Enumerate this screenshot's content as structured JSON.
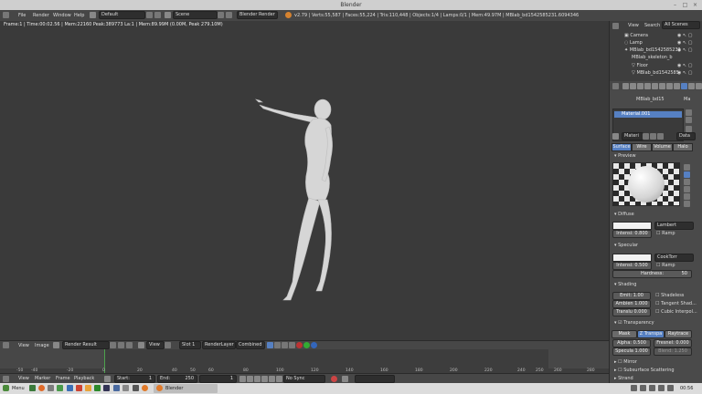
{
  "window": {
    "title": "Blender"
  },
  "topbar": {
    "menus": [
      "File",
      "Render",
      "Window",
      "Help"
    ],
    "layout": "Default",
    "scene": "Scene",
    "engine": "Blender Render",
    "stats": "v2.79 | Verts:55,587 | Faces:55,224 | Tris:110,448 | Objects:1/4 | Lamps:0/1 | Mem:49.97M | MBlab_bd1542585231.6094346"
  },
  "viewport": {
    "info": "Frame:1 | Time:00:02.56 | Mem:22160 Peak:389773 La:1 | Mem:89.99M (0.00M, Peak 279.10M)"
  },
  "image_editor_header": {
    "menus": [
      "View",
      "Image"
    ],
    "image_name": "Render Result",
    "view_label": "View",
    "slot": "Slot 1",
    "layer": "RenderLayer",
    "pass": "Combined"
  },
  "timeline": {
    "ticks": [
      "-50",
      "-40",
      "-20",
      "0",
      "20",
      "40",
      "50",
      "60",
      "80",
      "100",
      "120",
      "140",
      "160",
      "180",
      "200",
      "220",
      "240",
      "250",
      "260",
      "280"
    ],
    "menus": [
      "View",
      "Marker",
      "Frame",
      "Playback"
    ],
    "start_label": "Start:",
    "start_value": "1",
    "end_label": "End:",
    "end_value": "250",
    "current": "1",
    "sync": "No Sync"
  },
  "outliner": {
    "tabs": [
      "View",
      "Search",
      "All Scenes"
    ],
    "items": [
      "Camera",
      "Lamp",
      "MBlab_bd1542585231",
      "MBlab_skeleton_b",
      "Floor",
      "MBlab_bd1542585"
    ]
  },
  "properties": {
    "breadcrumb": [
      "MBlab_bd15",
      "Ma"
    ],
    "material_slot": "Material.001",
    "material_name": "Materi",
    "data_label": "Data",
    "tabs": [
      "Surface",
      "Wire",
      "Volume",
      "Halo"
    ],
    "sections": {
      "preview": "Preview",
      "diffuse": "Diffuse",
      "specular": "Specular",
      "shading": "Shading",
      "transparency": "Transparency",
      "mirror": "Mirror",
      "sss": "Subsurface Scattering",
      "strand": "Strand"
    },
    "diffuse": {
      "shader": "Lambert",
      "intensity_label": "Intensi",
      "intensity": "0.800",
      "ramp": "Ramp"
    },
    "specular": {
      "shader": "CookTorr",
      "intensity_label": "Intensi",
      "intensity": "0.500",
      "ramp": "Ramp",
      "hardness_label": "Hardness:",
      "hardness": "50"
    },
    "shading": {
      "emit_label": "Emit:",
      "emit": "1.00",
      "ambient_label": "Ambien",
      "ambient": "1.000",
      "translu_label": "Translu",
      "translu": "0.000",
      "shadeless": "Shadeless",
      "tangent": "Tangent Shad...",
      "cubic": "Cubic Interpol..."
    },
    "transparency": {
      "modes": [
        "Mask",
        "Z Transpa",
        "Raytrace"
      ],
      "alpha_label": "Alpha:",
      "alpha": "0.500",
      "fresnel_label": "Fresnel:",
      "fresnel": "0.000",
      "specular_label": "Specula",
      "specular": "1.000",
      "blend_label": "Blend:",
      "blend": "1.250"
    }
  },
  "taskbar": {
    "menu": "Menu",
    "task": "Blender",
    "clock": "00:56"
  },
  "colors": {
    "accent": "#5680c2",
    "figure": "#d8d8d8",
    "viewport_bg": "#3a3a3a",
    "panel_bg": "#4a4a4a"
  }
}
